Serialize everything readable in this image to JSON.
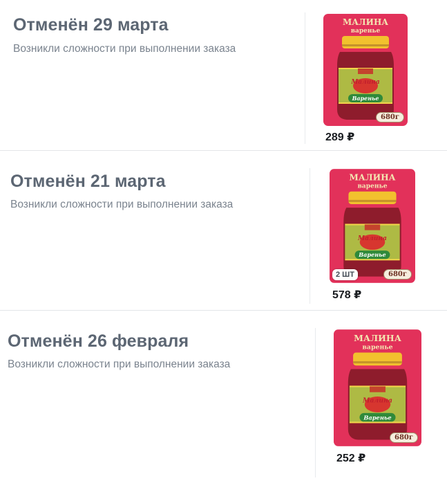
{
  "orders": [
    {
      "title": "Отменён 29 марта",
      "reason": "Возникли сложности при выполнении заказа",
      "product": {
        "brand_top": "МАЛИНА",
        "brand_sub": "варенье",
        "jar_label_1": "Малина",
        "jar_label_2": "Варенье",
        "weight": "680г",
        "quantity": ""
      },
      "price": "289 ₽"
    },
    {
      "title": "Отменён 21 марта",
      "reason": "Возникли сложности при выполнении заказа",
      "product": {
        "brand_top": "МАЛИНА",
        "brand_sub": "варенье",
        "jar_label_1": "Малина",
        "jar_label_2": "Варенье",
        "weight": "680г",
        "quantity": "2 ШТ"
      },
      "price": "578 ₽"
    },
    {
      "title": "Отменён 26 февраля",
      "reason": "Возникли сложности при выполнении заказа",
      "product": {
        "brand_top": "МАЛИНА",
        "brand_sub": "варенье",
        "jar_label_1": "Малина",
        "jar_label_2": "Варенье",
        "weight": "680г",
        "quantity": ""
      },
      "price": "252 ₽"
    }
  ],
  "colors": {
    "product_bg": "#e2315a",
    "jam": "#8e1c2c",
    "lid": "#f2c12e",
    "label_green": "#2f8a3a",
    "title": "#5c6673",
    "reason": "#7a838e"
  }
}
